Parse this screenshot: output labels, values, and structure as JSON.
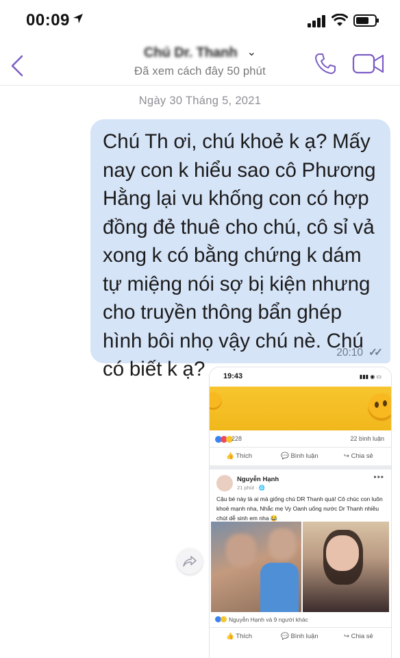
{
  "status_bar": {
    "time": "00:09"
  },
  "header": {
    "contact_name": "Chú Dr. Thanh",
    "last_seen": "Đã xem cách đây 50 phút"
  },
  "date_divider": "Ngày 30 Tháng 5, 2021",
  "message": {
    "text": "Chú Th ơi, chú khoẻ k ạ? Mấy nay con k hiểu sao cô Phương Hằng lại vu khống con có hợp đồng đẻ thuê cho chú, cô sỉ vả xong k có bằng chứng k dám tự miệng nói sợ bị kiện nhưng cho truyền thông bẩn ghép hình bôi nhọ vậy chú nè. Chú có biết k ạ?",
    "time": "20:10"
  },
  "screenshot": {
    "time": "19:43",
    "reaction_count": "228",
    "comment_count": "22 bình luận",
    "like_label": "Thích",
    "comment_label": "Bình luận",
    "share_label": "Chia sẻ",
    "post": {
      "author": "Nguyễn Hạnh",
      "time": "21 phút · ",
      "text": "Cậu bé này là ai mà giống chú DR Thanh quá! Cô chúc con luôn khoẻ mạnh nha, Nhắc mẹ Vy Oanh uống nước Dr Thanh nhiều chút dễ sinh em nha 😂",
      "reactions_text": "Nguyễn Hạnh và 9 người khác"
    }
  },
  "colors": {
    "accent": "#7b5cc4",
    "bubble": "#d6e4f8"
  },
  "icons": [
    "location-arrow-icon",
    "signal-icon",
    "wifi-icon",
    "battery-icon",
    "back-chevron-icon",
    "phone-icon",
    "video-call-icon",
    "share-forward-icon"
  ]
}
